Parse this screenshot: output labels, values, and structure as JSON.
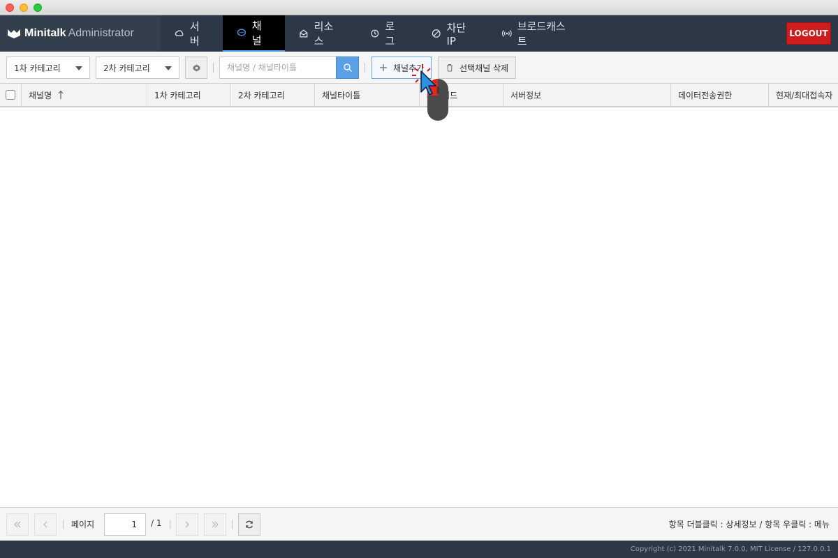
{
  "header": {
    "brand_name": "Minitalk",
    "brand_sub": "Administrator",
    "tabs": [
      {
        "label": "서버",
        "icon": "cloud-icon"
      },
      {
        "label": "채널",
        "icon": "chat-bubble-icon",
        "active": true
      },
      {
        "label": "리소스",
        "icon": "envelope-icon"
      },
      {
        "label": "로그",
        "icon": "history-icon"
      },
      {
        "label": "차단IP",
        "icon": "ban-icon"
      },
      {
        "label": "브로드캐스트",
        "icon": "broadcast-icon"
      }
    ],
    "logout_label": "LOGOUT"
  },
  "toolbar": {
    "category1": "1차 카테고리",
    "category2": "2차 카테고리",
    "search_placeholder": "채널명 / 채널타이틀",
    "add_label": "채널추가",
    "delete_label": "선택채널 삭제"
  },
  "grid": {
    "columns": [
      "채널명",
      "1차 카테고리",
      "2차 카테고리",
      "채널타이틀",
      "패스워드",
      "서버정보",
      "데이터전송권한",
      "현재/최대접속자"
    ],
    "rows": []
  },
  "pager": {
    "page_label": "페이지",
    "page_value": "1",
    "total_pages": "/ 1",
    "hint": "항목 더블클릭 : 상세정보 / 항목 우클릭 : 메뉴"
  },
  "footer": {
    "copyright": "Copyright (c) 2021 Minitalk 7.0.0, MIT License / 127.0.0.1"
  },
  "colors": {
    "nav_bg": "#2d3846",
    "accent": "#5aa0e6",
    "logout": "#cf1d1d"
  }
}
